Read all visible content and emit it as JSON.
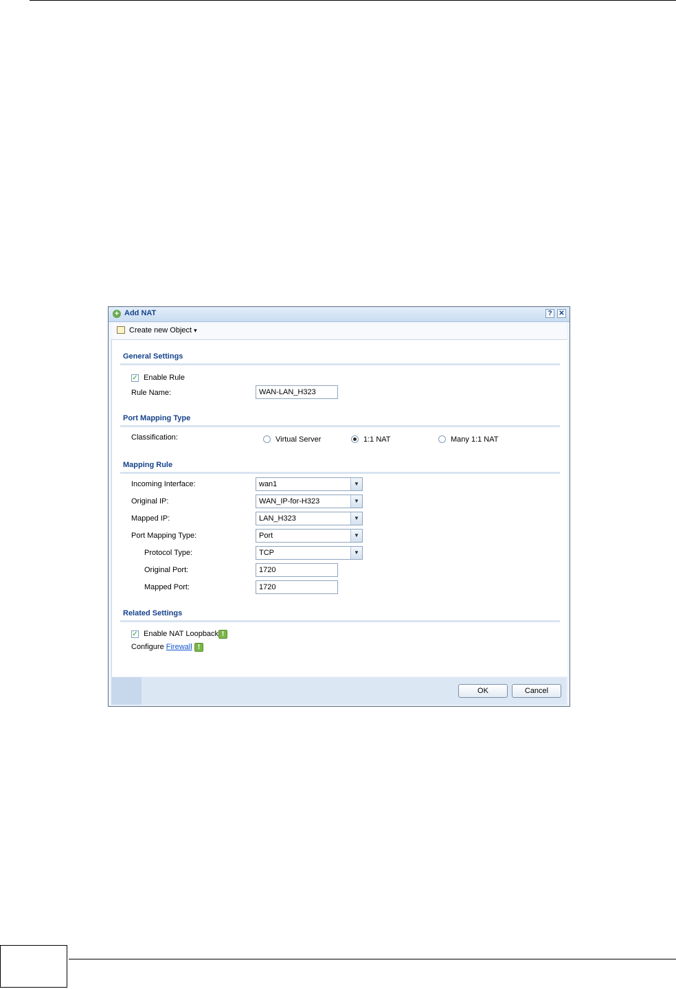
{
  "dialog": {
    "title": "Add NAT",
    "help_icon": "help-icon",
    "close_icon": "close-icon"
  },
  "toolbar": {
    "create_label": "Create new Object",
    "create_icon": "object-icon",
    "dropdown_arrow": "▾"
  },
  "general": {
    "title": "General Settings",
    "enable_rule_label": "Enable Rule",
    "enable_rule_checked": true,
    "rule_name_label": "Rule Name:",
    "rule_name_value": "WAN-LAN_H323"
  },
  "port_mapping": {
    "title": "Port Mapping Type",
    "classification_label": "Classification:",
    "options": [
      "Virtual Server",
      "1:1 NAT",
      "Many 1:1 NAT"
    ],
    "selected": "1:1 NAT"
  },
  "mapping_rule": {
    "title": "Mapping Rule",
    "incoming_interface_label": "Incoming Interface:",
    "incoming_interface_value": "wan1",
    "original_ip_label": "Original IP:",
    "original_ip_value": "WAN_IP-for-H323",
    "mapped_ip_label": "Mapped IP:",
    "mapped_ip_value": "LAN_H323",
    "port_mapping_type_label": "Port Mapping Type:",
    "port_mapping_type_value": "Port",
    "protocol_type_label": "Protocol Type:",
    "protocol_type_value": "TCP",
    "original_port_label": "Original Port:",
    "original_port_value": "1720",
    "mapped_port_label": "Mapped Port:",
    "mapped_port_value": "1720"
  },
  "related": {
    "title": "Related Settings",
    "nat_loopback_label": "Enable NAT Loopback",
    "nat_loopback_checked": true,
    "configure_label": "Configure",
    "firewall_link": "Firewall"
  },
  "buttons": {
    "ok": "OK",
    "cancel": "Cancel"
  },
  "colors": {
    "title_text": "#15428b",
    "link": "#1155cc",
    "info_icon": "#7ab648"
  }
}
